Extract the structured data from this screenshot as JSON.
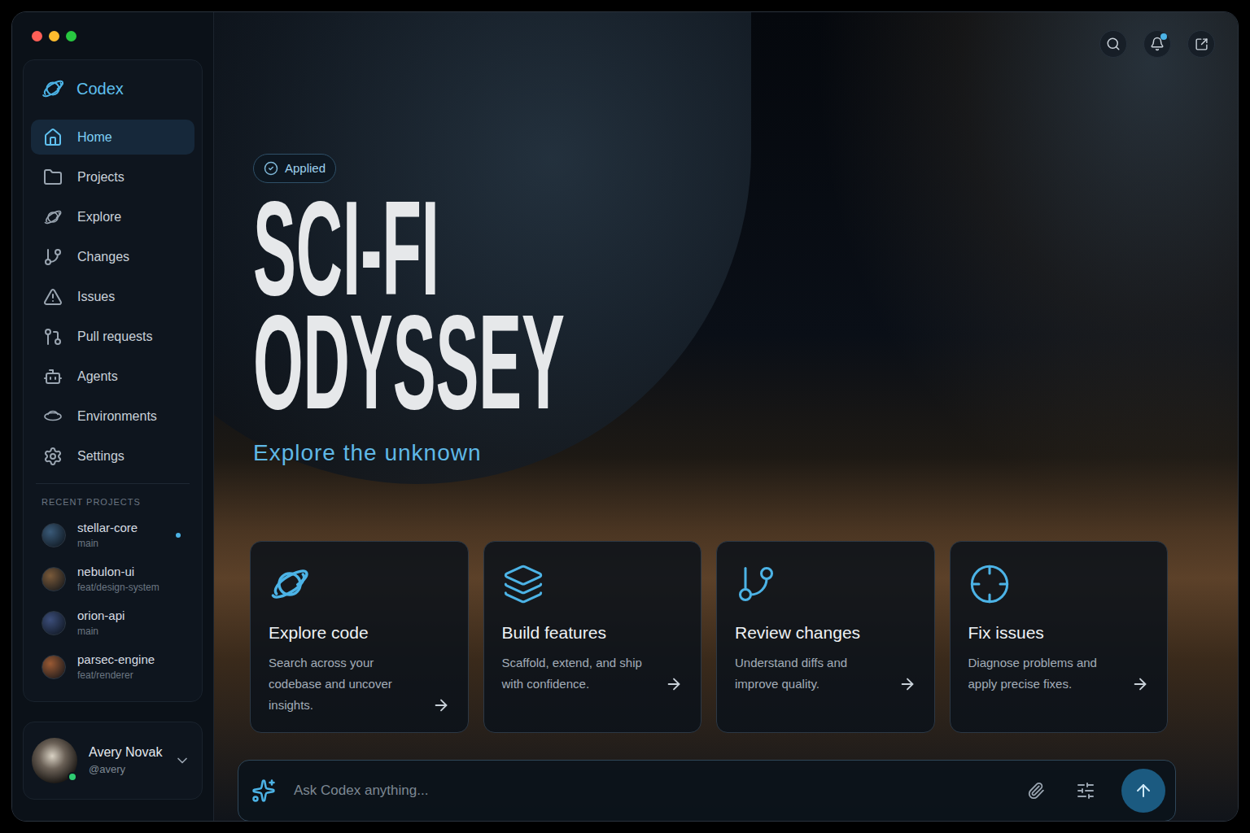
{
  "app": {
    "name": "Codex"
  },
  "sidebar": {
    "items": [
      {
        "label": "Home",
        "selected": true
      },
      {
        "label": "Projects",
        "selected": false
      },
      {
        "label": "Explore",
        "selected": false
      },
      {
        "label": "Changes",
        "selected": false
      },
      {
        "label": "Issues",
        "selected": false
      },
      {
        "label": "Pull requests",
        "selected": false
      },
      {
        "label": "Agents",
        "selected": false
      },
      {
        "label": "Environments",
        "selected": false
      },
      {
        "label": "Settings",
        "selected": false
      }
    ]
  },
  "recent_projects": {
    "title": "RECENT PROJECTS",
    "items": [
      {
        "name": "stellar-core",
        "branch": "main",
        "active": true,
        "color": "#3a5a78"
      },
      {
        "name": "nebulon-ui",
        "branch": "feat/design-system",
        "active": false,
        "color": "#7a5a3a"
      },
      {
        "name": "orion-api",
        "branch": "main",
        "active": false,
        "color": "#3c4e7a"
      },
      {
        "name": "parsec-engine",
        "branch": "feat/renderer",
        "active": false,
        "color": "#9a5a34"
      }
    ]
  },
  "user": {
    "name": "Avery Novak",
    "handle": "@avery",
    "online": true
  },
  "header": {
    "notification": true
  },
  "hero": {
    "badge": "Applied",
    "title_lines": [
      "SCI-FI",
      "ODYSSEY"
    ],
    "subtitle": "Explore the unknown"
  },
  "cards": [
    {
      "title": "Explore code",
      "description": "Search across your codebase and uncover insights."
    },
    {
      "title": "Build features",
      "description": "Scaffold, extend, and ship with confidence."
    },
    {
      "title": "Review changes",
      "description": "Understand diffs and improve quality."
    },
    {
      "title": "Fix issues",
      "description": "Diagnose problems and apply precise fixes."
    }
  ],
  "composer": {
    "placeholder": "Ask Codex anything..."
  }
}
